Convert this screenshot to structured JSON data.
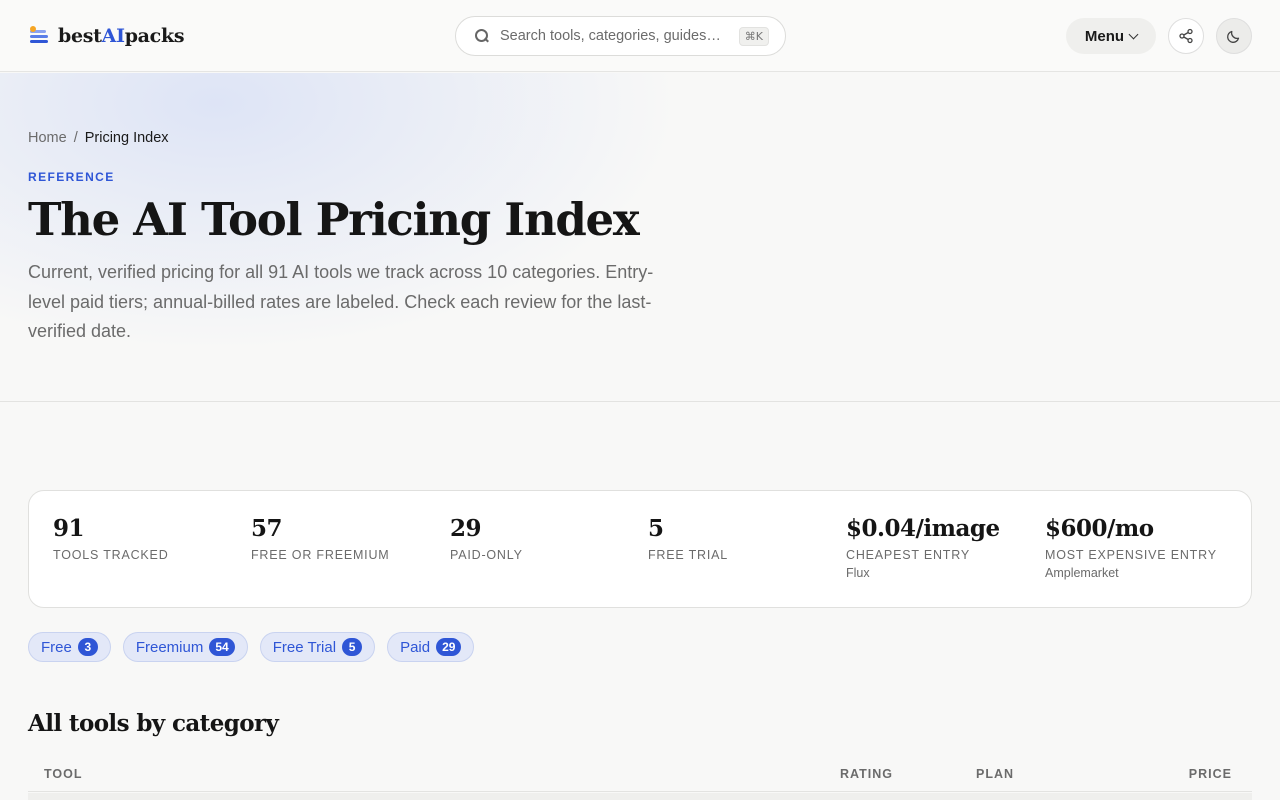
{
  "header": {
    "logo": {
      "part1": "best",
      "part2": "AI",
      "part3": "packs"
    },
    "search": {
      "placeholder": "Search tools, categories, guides…",
      "shortcut": "⌘K"
    },
    "menu_label": "Menu"
  },
  "hero": {
    "breadcrumb": {
      "home": "Home",
      "separator": "/",
      "current": "Pricing Index"
    },
    "eyebrow": "REFERENCE",
    "title": "The AI Tool Pricing Index",
    "subtitle": "Current, verified pricing for all 91 AI tools we track across 10 categories. Entry-level paid tiers; annual-billed rates are labeled. Check each review for the last-verified date."
  },
  "stats": [
    {
      "value": "91",
      "label": "TOOLS TRACKED",
      "sub": ""
    },
    {
      "value": "57",
      "label": "FREE OR FREEMIUM",
      "sub": ""
    },
    {
      "value": "29",
      "label": "PAID-ONLY",
      "sub": ""
    },
    {
      "value": "5",
      "label": "FREE TRIAL",
      "sub": ""
    },
    {
      "value": "$0.04/image",
      "label": "CHEAPEST ENTRY",
      "sub": "Flux"
    },
    {
      "value": "$600/mo",
      "label": "MOST EXPENSIVE ENTRY",
      "sub": "Amplemarket"
    }
  ],
  "filters": [
    {
      "label": "Free",
      "count": "3"
    },
    {
      "label": "Freemium",
      "count": "54"
    },
    {
      "label": "Free Trial",
      "count": "5"
    },
    {
      "label": "Paid",
      "count": "29"
    }
  ],
  "section_title": "All tools by category",
  "table": {
    "columns": {
      "tool": "TOOL",
      "rating": "RATING",
      "plan": "PLAN",
      "price": "PRICE"
    }
  },
  "colors": {
    "accent": "#2f56d6",
    "pill_bg": "#e3e8f8",
    "text": "#151515",
    "muted": "#6b6b6b"
  }
}
